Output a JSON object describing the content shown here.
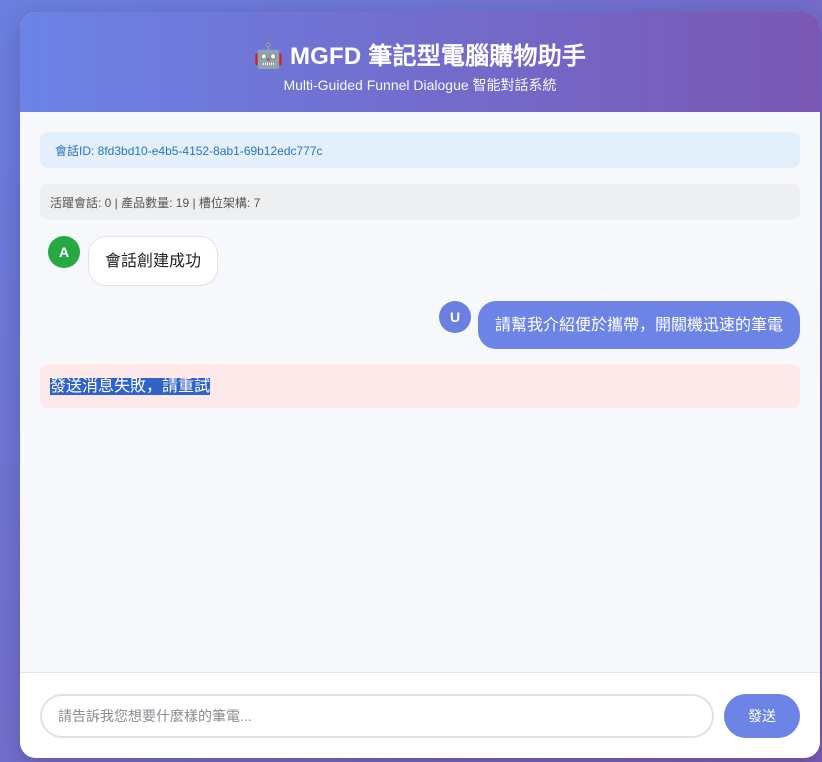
{
  "header": {
    "icon": "robot-icon",
    "icon_glyph": "🤖",
    "title": "MGFD 筆記型電腦購物助手",
    "subtitle": "Multi-Guided Funnel Dialogue 智能對話系統"
  },
  "session": {
    "text": "會話ID: 8fd3bd10-e4b5-4152-8ab1-69b12edc777c"
  },
  "stats": {
    "text": "活躍會話: 0 | 產品數量: 19 | 槽位架構: 7"
  },
  "messages": [
    {
      "role": "assistant",
      "avatar": "A",
      "text": "會話創建成功"
    },
    {
      "role": "user",
      "avatar": "U",
      "text": "請幫我介紹便於攜帶，開關機迅速的筆電"
    }
  ],
  "error": {
    "text": "發送消息失敗，請重試"
  },
  "input": {
    "value": "",
    "placeholder": "請告訴我您想要什麼樣的筆電..."
  },
  "send_button": {
    "label": "發送"
  },
  "colors": {
    "accent": "#6b84e6",
    "header_gradient_start": "#6b83e6",
    "header_gradient_end": "#7a57b4",
    "assistant_avatar": "#28a745",
    "error_bg": "#fde8ea",
    "session_bg": "#e3f0fb",
    "session_text": "#2a74b8"
  }
}
